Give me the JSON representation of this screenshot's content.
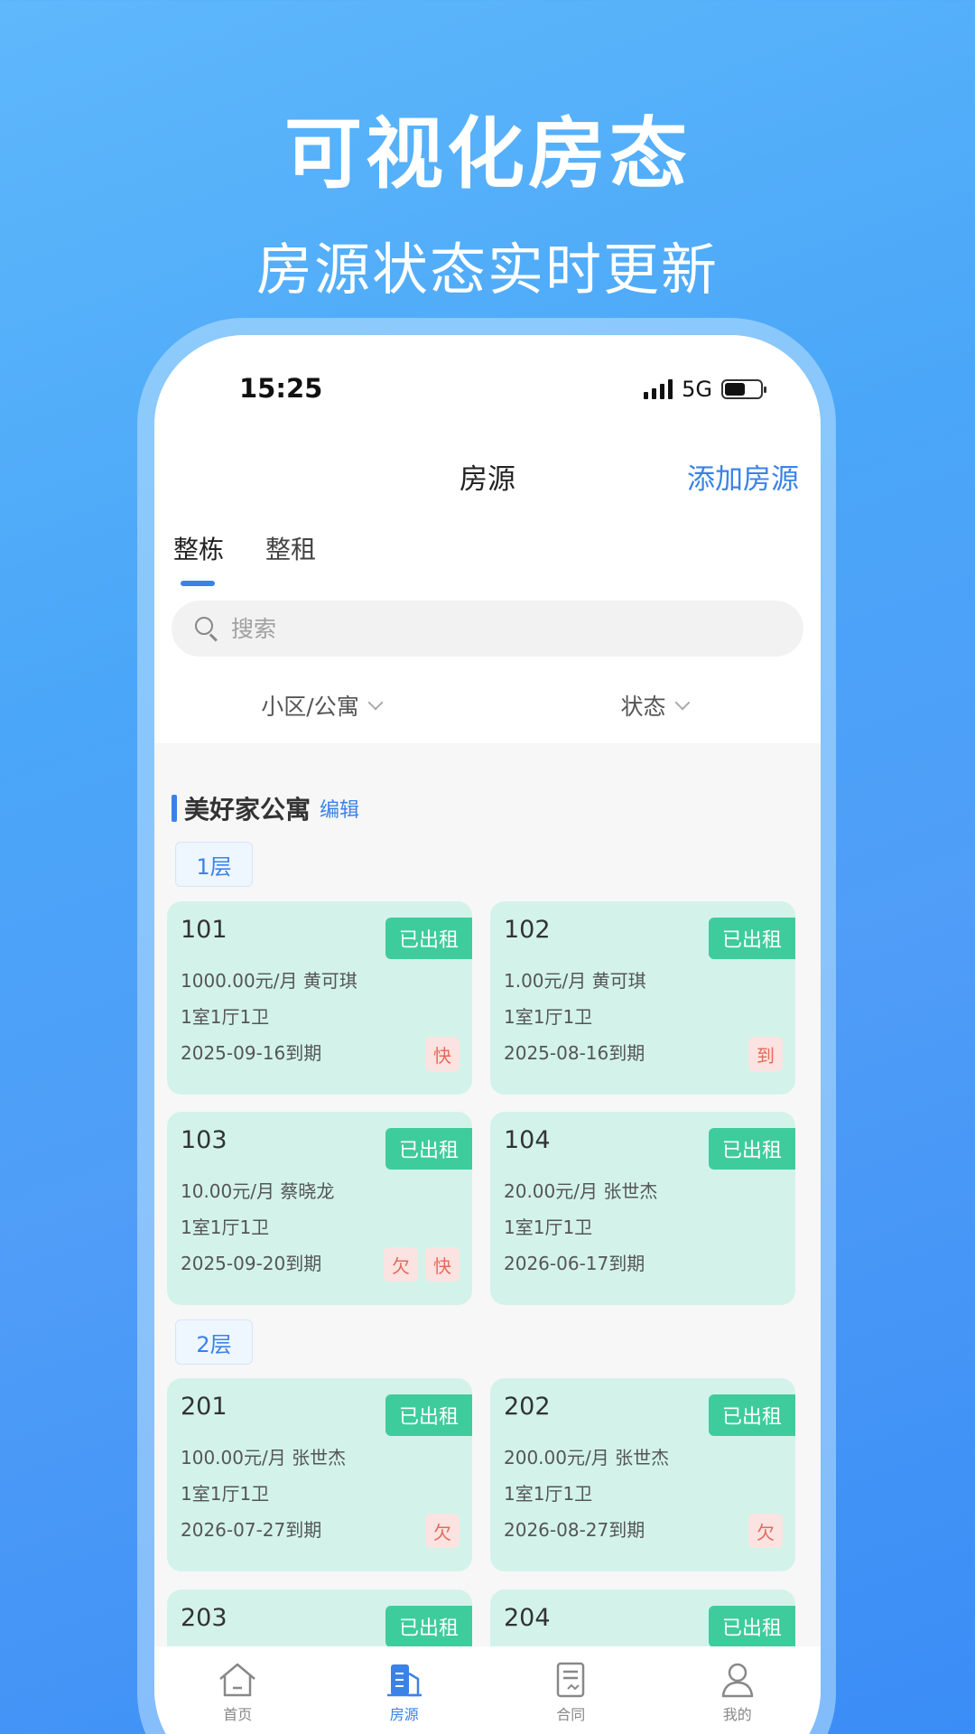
{
  "hero": {
    "title": "可视化房态",
    "subtitle": "房源状态实时更新"
  },
  "status_bar": {
    "time": "15:25",
    "network": "5G"
  },
  "nav": {
    "title": "房源",
    "action": "添加房源"
  },
  "tabs": [
    {
      "label": "整栋",
      "active": true
    },
    {
      "label": "整租",
      "active": false
    }
  ],
  "search": {
    "placeholder": "搜索"
  },
  "filters": [
    {
      "label": "小区/公寓"
    },
    {
      "label": "状态"
    }
  ],
  "section": {
    "name": "美好家公寓",
    "edit": "编辑"
  },
  "floors": [
    {
      "label": "1层"
    },
    {
      "label": "2层"
    }
  ],
  "rooms": [
    {
      "number": "101",
      "status": "已出租",
      "rent": "1000.00元/月",
      "tenant": "黄可琪",
      "layout": "1室1厅1卫",
      "due": "2025-09-16到期",
      "badges": [
        "快"
      ]
    },
    {
      "number": "102",
      "status": "已出租",
      "rent": "1.00元/月",
      "tenant": "黄可琪",
      "layout": "1室1厅1卫",
      "due": "2025-08-16到期",
      "badges": [
        "到"
      ]
    },
    {
      "number": "103",
      "status": "已出租",
      "rent": "10.00元/月",
      "tenant": "蔡晓龙",
      "layout": "1室1厅1卫",
      "due": "2025-09-20到期",
      "badges": [
        "欠",
        "快"
      ]
    },
    {
      "number": "104",
      "status": "已出租",
      "rent": "20.00元/月",
      "tenant": "张世杰",
      "layout": "1室1厅1卫",
      "due": "2026-06-17到期",
      "badges": []
    },
    {
      "number": "201",
      "status": "已出租",
      "rent": "100.00元/月",
      "tenant": "张世杰",
      "layout": "1室1厅1卫",
      "due": "2026-07-27到期",
      "badges": [
        "欠"
      ]
    },
    {
      "number": "202",
      "status": "已出租",
      "rent": "200.00元/月",
      "tenant": "张世杰",
      "layout": "1室1厅1卫",
      "due": "2026-08-27到期",
      "badges": [
        "欠"
      ]
    },
    {
      "number": "203",
      "status": "已出租"
    },
    {
      "number": "204",
      "status": "已出租"
    }
  ],
  "tabbar": [
    {
      "label": "首页",
      "icon": "home-icon"
    },
    {
      "label": "房源",
      "icon": "building-icon",
      "active": true
    },
    {
      "label": "合同",
      "icon": "contract-icon"
    },
    {
      "label": "我的",
      "icon": "user-icon"
    }
  ],
  "colors": {
    "accent": "#3b82e8",
    "rented_tag": "#3fcc9c",
    "room_bg": "#d3f3ea",
    "badge_text": "#e36b5c"
  }
}
